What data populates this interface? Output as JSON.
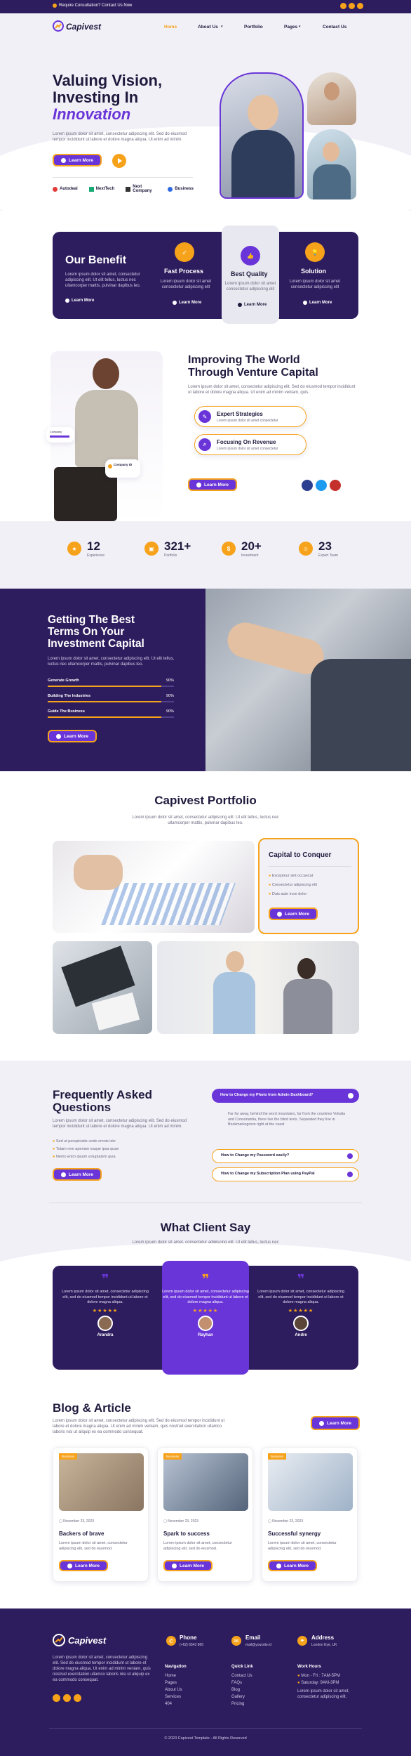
{
  "topbar": {
    "cta": "Require Consultation? Contact Us Now"
  },
  "nav": {
    "brand": "Capivest",
    "items": [
      "Home",
      "About Us",
      "Portfolio",
      "Pages",
      "Contact Us"
    ]
  },
  "hero": {
    "title_line1": "Valuing Vision,",
    "title_line2": "Investing In",
    "title_accent": "Innovation",
    "text": "Lorem ipsum dolor sit amet, consectetur adipiscing elit. Sed do eiusmod tempor incididunt ut labore et dolore magna aliqua. Ut enim ad minim.",
    "button": "Learn More",
    "partners": [
      "Autodeal",
      "NextTech",
      "Next Company",
      "Business"
    ]
  },
  "benefit": {
    "title": "Our Benefit",
    "text": "Lorem ipsum dolor sit amet, consectetur adipiscing elit. Ut elit tellus, luctus nec ullamcorper mattis, pulvinar dapibus leo.",
    "link": "Learn More",
    "items": [
      {
        "title": "Fast Process",
        "text": "Lorem ipsum dolor sit amet consectetur adipiscing elit",
        "link": "Learn More"
      },
      {
        "title": "Best Quality",
        "text": "Lorem ipsum dolor sit amet consectetur adipiscing elit",
        "link": "Learn More"
      },
      {
        "title": "Solution",
        "text": "Lorem ipsum dolor sit amet consectetur adipiscing elit",
        "link": "Learn More"
      }
    ]
  },
  "about": {
    "title_line1": "Improving The World",
    "title_line2": "Through Venture Capital",
    "text": "Lorem ipsum dolor sit amet, consectetur adipiscing elit. Sed do eiusmod tempor incididunt ut labore et dolore magna aliqua. Ut enim ad minim veniam, quis.",
    "features": [
      {
        "title": "Expert Strategies",
        "text": "Lorem ipsum dolor sit amet consectetur"
      },
      {
        "title": "Focusing On Revenue",
        "text": "Lorem ipsum dolor sit amet consectetur"
      }
    ],
    "button": "Learn More",
    "card1_label": "Company",
    "card2_label": "Company ID"
  },
  "stats": [
    {
      "value": "12",
      "label": "Experience"
    },
    {
      "value": "321+",
      "label": "Portfolio"
    },
    {
      "value": "20+",
      "label": "Investment"
    },
    {
      "value": "23",
      "label": "Expert Team"
    }
  ],
  "capital": {
    "title_line1": "Getting The Best",
    "title_line2": "Terms On Your",
    "title_line3": "Investment Capital",
    "text": "Lorem ipsum dolor sit amet, consectetur adipiscing elit. Ut elit tellus, luctus nec ullamcorper mattis, pulvinar dapibus leo.",
    "bars": [
      {
        "label": "Generate Growth",
        "value": "90%",
        "pct": 0.9
      },
      {
        "label": "Building The Industries",
        "value": "90%",
        "pct": 0.9
      },
      {
        "label": "Guide The Business",
        "value": "90%",
        "pct": 0.9
      }
    ],
    "button": "Learn More"
  },
  "portfolio": {
    "title": "Capivest Portfolio",
    "text": "Lorem ipsum dolor sit amet, consectetur adipiscing elit. Ut elit tellus, luctus nec ullamcorper mattis, pulvinar dapibus leo.",
    "card_title": "Capital to Conquer",
    "card_items": [
      "Excepteur sint occaecat",
      "Consectetur adipiscing elit",
      "Duis aute irure dolor"
    ],
    "card_button": "Learn More"
  },
  "faq": {
    "title_line1": "Frequently Asked",
    "title_line2": "Questions",
    "text": "Lorem ipsum dolor sit amet, consectetur adipiscing elit. Sed do eiusmod tempor incididunt ut labore et dolore magna aliqua. Ut enim ad minim.",
    "list": [
      "Sed ut perspiciatis unde omnis iste",
      "Totam rem aperiam eaque ipsa quae",
      "Nemo enim ipsam voluptatem quia"
    ],
    "button": "Learn More",
    "open_q": "How to Change my Photo from Admin Dashboard?",
    "answer": "Far far away, behind the word mountains, far from the countries Vokalia and Consonantia, there live the blind texts. Separated they live in Bookmarksgrove right at the coast",
    "q2": "How to Change my Password easily?",
    "q3": "How to Change my Subscription Plan using PayPal"
  },
  "testimonials": {
    "title": "What Client Say",
    "text": "Lorem ipsum dolor sit amet, consectetur adipiscing elit. Ut elit tellus, luctus nec ullamcorper mattis, pulvinar dapibus leo.",
    "items": [
      {
        "text": "Lorem ipsum dolor sit amet, consectetur adipiscing elit, sed do eiusmod tempor incididunt ut labore et dolore magna aliqua.",
        "name": "Arandra"
      },
      {
        "text": "Lorem ipsum dolor sit amet, consectetur adipiscing elit, sed do eiusmod tempor incididunt ut labore et dolore magna aliqua.",
        "name": "Rayhan"
      },
      {
        "text": "Lorem ipsum dolor sit amet, consectetur adipiscing elit, sed do eiusmod tempor incididunt ut labore et dolore magna aliqua.",
        "name": "Andre"
      }
    ]
  },
  "blog": {
    "title": "Blog & Article",
    "text": "Lorem ipsum dolor sit amet, consectetur adipiscing elit. Sed do eiusmod tempor incididunt ut labore et dolore magna aliqua. Ut enim ad minim veniam, quis nostrud exercitation ullamco laboris nisi ut aliquip ex ea commodo consequat.",
    "button": "Learn More",
    "posts": [
      {
        "tag": "Business",
        "date": "November 23, 2023",
        "title": "Backers of brave",
        "text": "Lorem ipsum dolor sit amet, consectetur adipiscing elit, sed do eiusmod.",
        "button": "Learn More"
      },
      {
        "tag": "Business",
        "date": "November 23, 2023",
        "title": "Spark to success",
        "text": "Lorem ipsum dolor sit amet, consectetur adipiscing elit, sed do eiusmod.",
        "button": "Learn More"
      },
      {
        "tag": "Business",
        "date": "November 23, 2023",
        "title": "Successful synergy",
        "text": "Lorem ipsum dolor sit amet, consectetur adipiscing elit, sed do eiusmod.",
        "button": "Learn More"
      }
    ]
  },
  "footer": {
    "brand": "Capivest",
    "text": "Lorem ipsum dolor sit amet, consectetur adipiscing elit. Sed do eiusmod tempor incididunt ut labore et dolore magna aliqua. Ut enim ad minim veniam, quis nostrud exercitation ullamco laboris nisi ut aliquip ex ea commodo consequat.",
    "phone_title": "Phone",
    "phone": "(+62) 6543 865",
    "email_title": "Email",
    "email": "mail@yoursite.id",
    "address_title": "Address",
    "address": "London Eye, UK",
    "nav_title": "Navigation",
    "nav": [
      "Home",
      "Pages",
      "About Us",
      "Services",
      "404"
    ],
    "quick_title": "Quick Link",
    "quick": [
      "Contact Us",
      "FAQs",
      "Blog",
      "Gallery",
      "Pricing"
    ],
    "hours_title": "Work Hours",
    "hours": [
      "Mon - Fri : 7AM-5PM",
      "Saturday: 9AM-3PM"
    ],
    "hours_text": "Lorem ipsum dolor sit amet, consectetur adipiscing elit.",
    "copyright": "© 2023 Capivest Template - All Rights Reserved"
  },
  "colors": {
    "primary": "#6a35d8",
    "dark": "#2e1d5e",
    "accent": "#f7a21b"
  }
}
